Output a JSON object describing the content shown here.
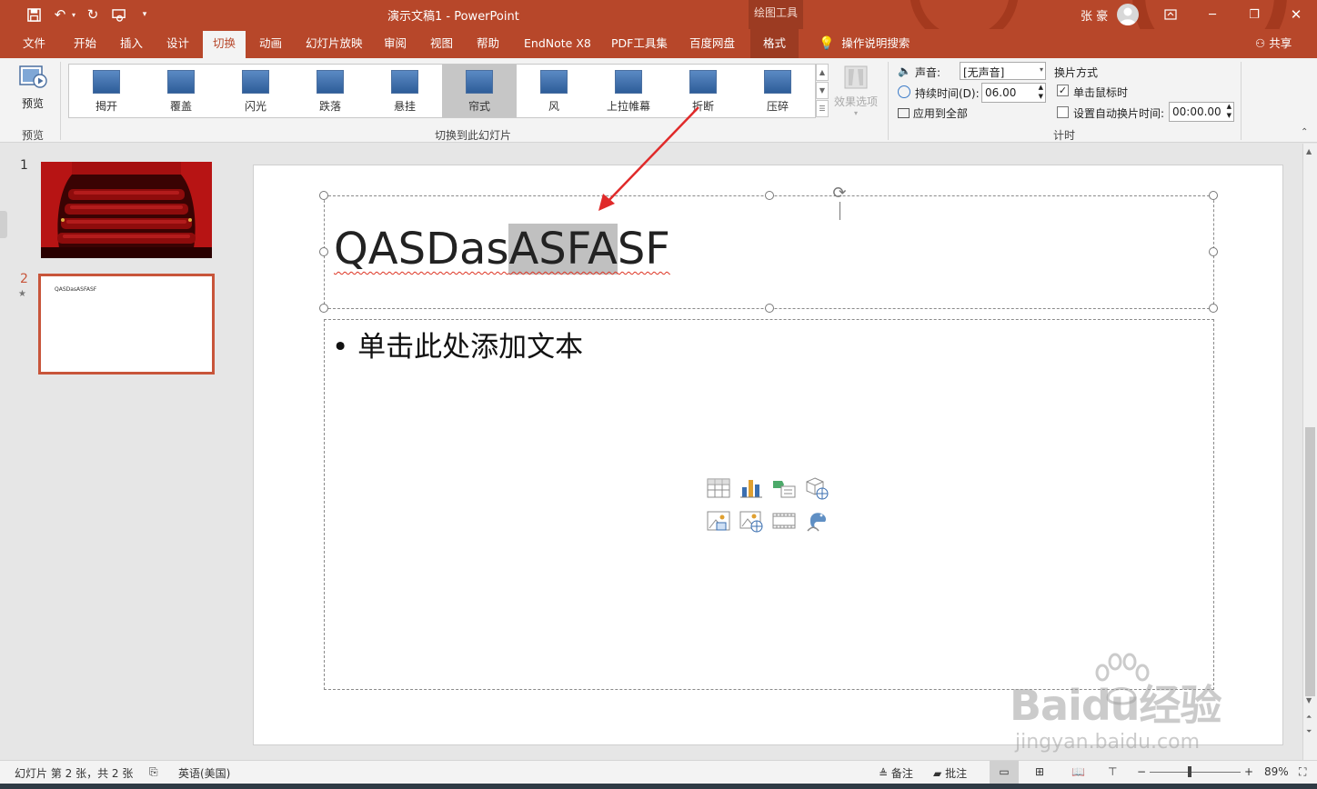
{
  "titlebar": {
    "doc_title": "演示文稿1  -  PowerPoint",
    "context_group": "绘图工具",
    "user": "张 豪"
  },
  "tabs": [
    "文件",
    "开始",
    "插入",
    "设计",
    "切换",
    "动画",
    "幻灯片放映",
    "审阅",
    "视图",
    "帮助",
    "EndNote X8",
    "PDF工具集",
    "百度网盘",
    "格式"
  ],
  "active_tab": "切换",
  "help_search": "操作说明搜索",
  "share": "共享",
  "ribbon": {
    "preview_label": "预览",
    "preview_group": "预览",
    "transitions_group": "切换到此幻灯片",
    "effects": [
      {
        "label": "揭开",
        "icon": "uncover-icon"
      },
      {
        "label": "覆盖",
        "icon": "cover-icon"
      },
      {
        "label": "闪光",
        "icon": "flash-icon"
      },
      {
        "label": "跌落",
        "icon": "fall-icon"
      },
      {
        "label": "悬挂",
        "icon": "drape-icon"
      },
      {
        "label": "帘式",
        "icon": "curtains-icon"
      },
      {
        "label": "风",
        "icon": "wind-icon"
      },
      {
        "label": "上拉帷幕",
        "icon": "prestige-icon"
      },
      {
        "label": "折断",
        "icon": "fracture-icon"
      },
      {
        "label": "压碎",
        "icon": "crush-icon"
      }
    ],
    "selected_effect": "帘式",
    "effect_options": "效果选项",
    "sound_label": "声音:",
    "sound_value": "[无声音]",
    "duration_label": "持续时间(D):",
    "duration_value": "06.00",
    "apply_all": "应用到全部",
    "advance_title": "换片方式",
    "on_click": "单击鼠标时",
    "on_click_checked": true,
    "after_label": "设置自动换片时间:",
    "after_value": "00:00.00",
    "after_checked": false,
    "timing_group": "计时"
  },
  "slides": [
    {
      "number": "1",
      "text": ""
    },
    {
      "number": "2",
      "text": "QASDasASFASF"
    }
  ],
  "slide": {
    "title_before": "QASDas",
    "title_selected": "ASFA",
    "title_after": "SF",
    "body_bullet": "单击此处添加文本"
  },
  "status": {
    "slide_info": "幻灯片 第 2 张，共 2 张",
    "language": "英语(美国)",
    "notes": "备注",
    "comments": "批注",
    "zoom": "89%"
  },
  "watermark": {
    "brand": "Baidu经验",
    "url": "jingyan.baidu.com"
  },
  "colors": {
    "accent": "#b7472a",
    "selection": "#c0c0c0",
    "arrow": "#e02a2a"
  }
}
